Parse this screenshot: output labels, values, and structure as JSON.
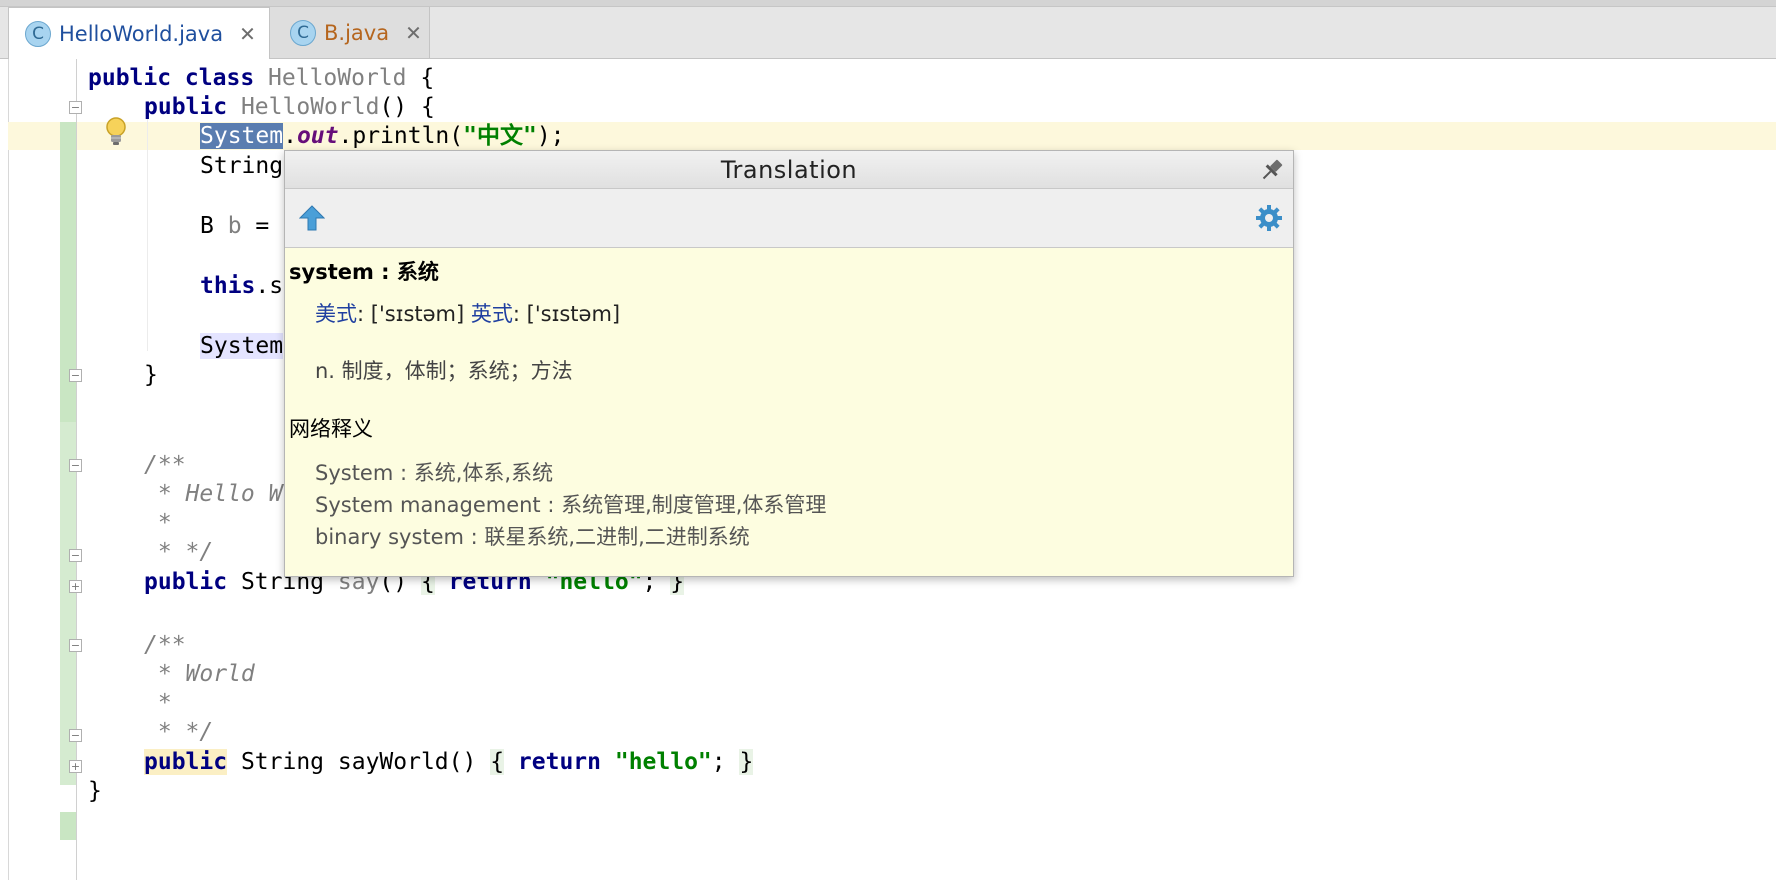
{
  "tabs": [
    {
      "label": "HelloWorld.java",
      "icon": "class-icon",
      "icon_letter": "C",
      "active": true
    },
    {
      "label": "B.java",
      "icon": "class-icon",
      "icon_letter": "C",
      "active": false
    }
  ],
  "code": {
    "l1_kw": "public class",
    "l1_name": "HelloWorld",
    "l1_tail": " {",
    "l2_kw": "public",
    "l2_name": "HelloWorld",
    "l2_tail": "() {",
    "l3_sel": "System",
    "l3_dot": ".",
    "l3_out": "out",
    "l3_mid": ".println(",
    "l3_str": "\"中文\"",
    "l3_end": ");",
    "l4": "String",
    "l5_a": "B ",
    "l5_b": "b",
    "l5_c": " =",
    "l6_kw": "this",
    "l6_tail": ".s",
    "l7": "System",
    "l8": "}",
    "c1_open": "/**",
    "c1_line": " * Hello W",
    "c1_star": " *",
    "c1_close": " * */",
    "say_kw": "public",
    "say_type": " String ",
    "say_name": "say",
    "say_paren": "() ",
    "say_brace1": "{",
    "say_ret": " return ",
    "say_str": "\"hello\"",
    "say_semi": "; ",
    "say_brace2": "}",
    "c2_open": "/**",
    "c2_line": " * World",
    "c2_star": " *",
    "c2_close": " * */",
    "sw_kw": "public",
    "sw_type": " String ",
    "sw_name": "sayWorld",
    "sw_paren": "() ",
    "sw_brace1": "{",
    "sw_ret": " return ",
    "sw_str": "\"hello\"",
    "sw_semi": "; ",
    "sw_brace2": "}",
    "end": "}"
  },
  "icons": {
    "bulb": "lightbulb-icon",
    "pin": "pin-icon",
    "up": "arrow-up-icon",
    "gear": "gear-icon"
  },
  "popup": {
    "title": "Translation",
    "headword": "system : 系统",
    "us_label": "美式",
    "us_phon": ": ['sɪstəm]",
    "uk_label": "英式",
    "uk_phon": ": ['sɪstəm]",
    "definition": "n. 制度，体制；系统；方法",
    "web_heading": "网络释义",
    "web_items": [
      "System : 系统,体系,系统",
      "System management : 系统管理,制度管理,体系管理",
      "binary system : 联星系统,二进制,二进制系统"
    ]
  },
  "colors": {
    "keyword": "#000080",
    "string": "#008000",
    "selection": "#5a7db0",
    "popup_bg": "#fdfde0",
    "active_tab_text": "#1f4f9e",
    "inactive_tab_text": "#b5651d"
  }
}
